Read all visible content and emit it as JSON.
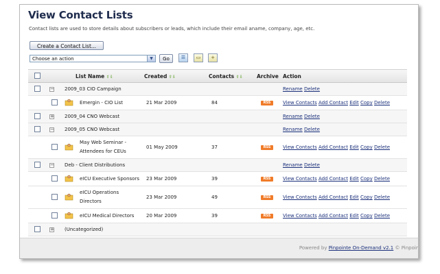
{
  "page": {
    "title": "View Contact Lists",
    "description": "Contact lists are used to store details about subscribers or leads, which include their email aname, company, age, etc.",
    "create_button": "Create a Contact List...",
    "action_select": "Choose an action",
    "go_button": "Go"
  },
  "table": {
    "headers": {
      "list_name": "List Name",
      "created": "Created",
      "contacts": "Contacts",
      "archive": "Archive",
      "action": "Action"
    },
    "rss_label": "RSS",
    "actions": {
      "rename": "Rename",
      "delete": "Delete",
      "view": "View Contacts",
      "add": "Add Contact",
      "edit": "Edit",
      "copy": "Copy"
    },
    "rows": [
      {
        "type": "group",
        "expander": "−",
        "name": "2009_03 CIO Campaign"
      },
      {
        "type": "list",
        "name": "Emergin - CIO List",
        "created": "21 Mar 2009",
        "contacts": "84"
      },
      {
        "type": "group",
        "expander": "+",
        "name": "2009_04 CNO Webcast"
      },
      {
        "type": "group",
        "expander": "−",
        "name": "2009_05 CNO Webcast"
      },
      {
        "type": "list",
        "name1": "May Web Seminar -",
        "name2": "Attendees for CEUs",
        "created": "01 May 2009",
        "contacts": "37"
      },
      {
        "type": "group",
        "expander": "−",
        "name": "Deb - Client Distributions"
      },
      {
        "type": "list",
        "name": "eICU Executive Sponsors",
        "created": "23 Mar 2009",
        "contacts": "39"
      },
      {
        "type": "list",
        "name1": "eICU Operations",
        "name2": "Directors",
        "created": "23 Mar 2009",
        "contacts": "49"
      },
      {
        "type": "list",
        "name": "eICU Medical Directors",
        "created": "20 Mar 2009",
        "contacts": "39"
      },
      {
        "type": "group",
        "expander": "+",
        "name": "(Uncategorized)"
      }
    ]
  },
  "footer": {
    "prefix": "Powered by",
    "link": "Pinpointe On-Demand v2.1",
    "suffix": "© Pinpoint"
  },
  "colors": {
    "title": "#1f2c4d",
    "link": "#1a2f7a",
    "rss": "#f07c2a"
  },
  "icons": [
    "checkbox-icon",
    "expand-icon",
    "collapse-icon",
    "contact-list-icon",
    "rss-icon",
    "sort-arrows-icon",
    "view-list-icon",
    "folder-icon",
    "add-folder-icon",
    "dropdown-arrow-icon"
  ]
}
